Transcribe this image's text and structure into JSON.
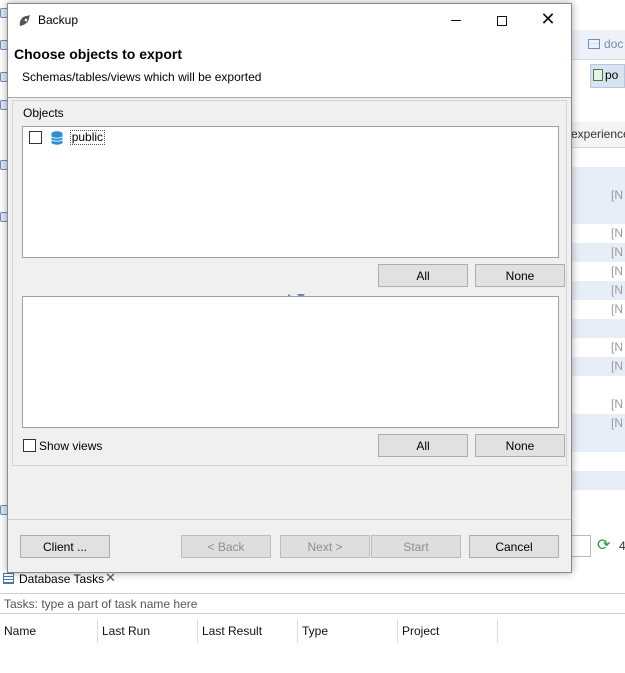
{
  "dialog": {
    "title": "Backup",
    "heading": "Choose objects to export",
    "description": "Schemas/tables/views which will be exported",
    "group_label": "Objects",
    "tree_items": [
      {
        "label": "public",
        "checked": false
      }
    ],
    "top_buttons": {
      "all": "All",
      "none": "None"
    },
    "bottom_buttons": {
      "all": "All",
      "none": "None"
    },
    "show_views": {
      "label": "Show views",
      "checked": false
    },
    "footer": {
      "client": "Client ...",
      "back": "< Back",
      "next": "Next >",
      "start": "Start",
      "cancel": "Cancel"
    }
  },
  "background": {
    "tab_doc": "doc",
    "tab_po": "po",
    "column_header": "experience",
    "null_cells": [
      "[N",
      "[N",
      "[N",
      "[N",
      "[N",
      "[N",
      "[N",
      "[N",
      "[N",
      "[N"
    ],
    "refresh_count": "4",
    "db_tasks_tab": "Database Tasks",
    "tasks_filter_placeholder": "Tasks: type a part of task name here",
    "task_columns": [
      "Name",
      "Last Run",
      "Last Result",
      "Type",
      "Project"
    ]
  },
  "colors": {
    "dialog_bg": "#f0f0f0",
    "row_alt": "#e8eef8",
    "accent": "#6b84b6"
  }
}
